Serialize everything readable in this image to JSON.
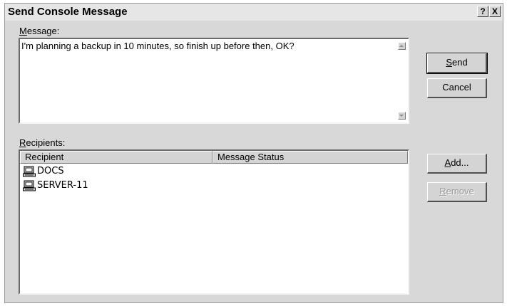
{
  "dialog": {
    "title": "Send Console Message",
    "help_label": "?",
    "close_label": "X"
  },
  "message": {
    "label_accel": "M",
    "label_rest": "essage:",
    "value": "I'm planning a backup in 10 minutes, so finish up before then, OK?"
  },
  "buttons": {
    "send_accel": "S",
    "send_rest": "end",
    "cancel": "Cancel",
    "add_accel": "A",
    "add_rest": "dd...",
    "remove_accel": "R",
    "remove_rest": "emove"
  },
  "recipients": {
    "label_accel": "R",
    "label_rest": "ecipients:",
    "columns": [
      "Recipient",
      "Message Status"
    ],
    "rows": [
      {
        "name": "DOCS",
        "icon": "computer-icon",
        "status": ""
      },
      {
        "name": "SERVER-11",
        "icon": "computer-icon",
        "status": ""
      }
    ]
  }
}
